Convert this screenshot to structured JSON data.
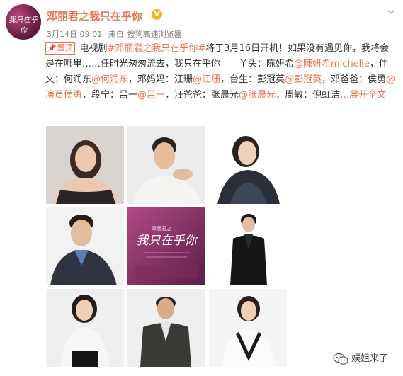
{
  "header": {
    "account_name": "邓丽君之我只在乎你",
    "avatar_text": "我只在乎你",
    "verified_icon": "verified-badge-icon",
    "date": "3月14日 09:01",
    "source_prefix": "来自",
    "source": "搜狗高速浏览器"
  },
  "post": {
    "pin_label": "置顶",
    "segments": [
      {
        "text": "电视剧",
        "link": false
      },
      {
        "text": "#邓丽君之我只在乎你#",
        "link": true
      },
      {
        "text": "将于3月16日开机！如果没有遇见你，我将会是在哪里……任时光匆匆流去，我只在乎你——丫头：陈妍希",
        "link": false
      },
      {
        "text": "@陳妍希michelle",
        "link": true
      },
      {
        "text": "，仲文：何润东",
        "link": false
      },
      {
        "text": "@何润东",
        "link": true
      },
      {
        "text": "，邓妈妈：江珊",
        "link": false
      },
      {
        "text": "@江珊",
        "link": true
      },
      {
        "text": "，台生：彭冠英",
        "link": false
      },
      {
        "text": "@彭冠英",
        "link": true
      },
      {
        "text": "，邓爸爸：侯勇",
        "link": false
      },
      {
        "text": "@演员侯勇",
        "link": true
      },
      {
        "text": "，段宁：吕一",
        "link": false
      },
      {
        "text": "@吕一",
        "link": true
      },
      {
        "text": "，汪爸爸：张晨光",
        "link": false
      },
      {
        "text": "@张晨光",
        "link": true
      },
      {
        "text": "，周敏：倪虹洁",
        "link": false
      },
      {
        "text": "…展开全文",
        "link": true
      }
    ]
  },
  "grid": {
    "poster_title": "我只在乎你",
    "poster_subtitle": "邓丽君之"
  },
  "footer": {
    "wechat_label": "娱姐来了"
  }
}
